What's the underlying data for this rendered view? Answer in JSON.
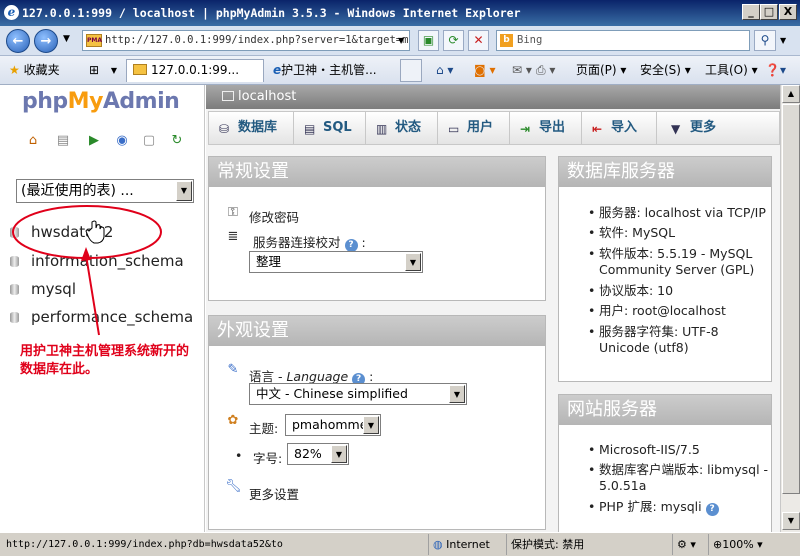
{
  "window": {
    "title": "127.0.0.1:999 / localhost | phpMyAdmin 3.5.3 - Windows Internet Explorer",
    "min_glyph": "_",
    "max_glyph": "□",
    "close_glyph": "X"
  },
  "address_bar": {
    "url": "http://127.0.0.1:999/index.php?server=1&target=m",
    "search_placeholder": "Bing",
    "search_icon_glyph": "b"
  },
  "tabs_row": {
    "favorites_label": "收藏夹",
    "tabs": [
      {
        "label": "127.0.0.1:99...",
        "active": true
      },
      {
        "label": "护卫神・主机管..."
      }
    ],
    "commands": {
      "page": "页面(P) ▾",
      "safety": "安全(S) ▾",
      "tools": "工具(O) ▾"
    }
  },
  "left": {
    "logo": {
      "php": "php",
      "my": "My",
      "admin": "Admin"
    },
    "recent_select": "(最近使用的表) ...",
    "databases": [
      "hwsdata52",
      "information_schema",
      "mysql",
      "performance_schema"
    ],
    "annotation": "用护卫神主机管理系统新开的数据库在此。"
  },
  "main": {
    "breadcrumb": "localhost",
    "menu": [
      {
        "label": "数据库",
        "icon": "database-icon"
      },
      {
        "label": "SQL",
        "icon": "sql-icon"
      },
      {
        "label": "状态",
        "icon": "status-icon"
      },
      {
        "label": "用户",
        "icon": "users-icon"
      },
      {
        "label": "导出",
        "icon": "export-icon"
      },
      {
        "label": "导入",
        "icon": "import-icon"
      },
      {
        "label": "更多",
        "icon": "more-icon"
      }
    ],
    "general": {
      "title": "常规设置",
      "change_password": "修改密码",
      "collation_label": "服务器连接校对",
      "collation_colon": ":",
      "collation_value": "整理"
    },
    "appearance": {
      "title": "外观设置",
      "language_label": "语言 - ",
      "language_en": "Language",
      "language_colon": ":",
      "language_value": "中文 - Chinese simplified",
      "theme_label": "主题:",
      "theme_value": "pmahomme",
      "fontsize_label": "字号:",
      "fontsize_value": "82%",
      "more_settings": "更多设置"
    },
    "db_server": {
      "title": "数据库服务器",
      "items": [
        "服务器: localhost via TCP/IP",
        "软件: MySQL",
        "软件版本: 5.5.19 - MySQL Community Server (GPL)",
        "协议版本: 10",
        "用户: root@localhost",
        "服务器字符集: UTF-8 Unicode (utf8)"
      ]
    },
    "web_server": {
      "title": "网站服务器",
      "items": [
        "Microsoft-IIS/7.5",
        "数据库客户端版本: libmysql - 5.0.51a",
        "PHP 扩展: mysqli"
      ]
    }
  },
  "status_bar": {
    "url": "http://127.0.0.1:999/index.php?db=hwsdata52&to",
    "zone": "Internet",
    "protected_mode": "保护模式: 禁用",
    "zoom": "100%"
  },
  "colors": {
    "pma_link": "#235a81",
    "annotation_red": "#e0001a",
    "panel_header": "#b5b5b5"
  }
}
